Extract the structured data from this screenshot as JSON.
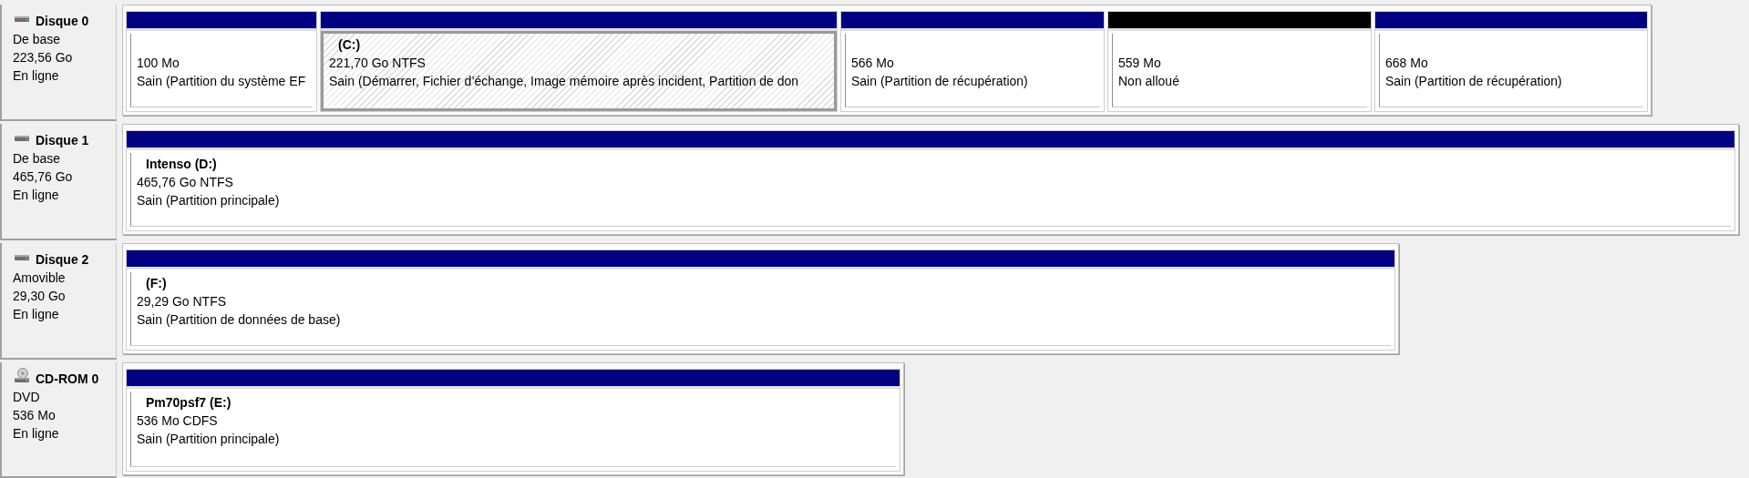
{
  "disks": [
    {
      "name": "Disque 0",
      "kind": "disk",
      "type": "De base",
      "size": "223,56 Go",
      "status": "En ligne",
      "partitions": [
        {
          "kind": "allocated",
          "selected": false,
          "size": "100 Mo",
          "status": "Sain (Partition du système EF"
        },
        {
          "kind": "allocated",
          "selected": true,
          "label": "(C:)",
          "size": "221,70 Go NTFS",
          "status": "Sain (Démarrer, Fichier d’échange, Image mémoire après incident, Partition de don"
        },
        {
          "kind": "allocated",
          "selected": false,
          "size": "566 Mo",
          "status": "Sain (Partition de récupération)"
        },
        {
          "kind": "unallocated",
          "selected": false,
          "size": "559 Mo",
          "status": "Non alloué"
        },
        {
          "kind": "allocated",
          "selected": false,
          "size": "668 Mo",
          "status": "Sain (Partition de récupération)"
        }
      ]
    },
    {
      "name": "Disque 1",
      "kind": "disk",
      "type": "De base",
      "size": "465,76 Go",
      "status": "En ligne",
      "partitions": [
        {
          "kind": "allocated",
          "selected": false,
          "label": "Intenso  (D:)",
          "size": "465,76 Go NTFS",
          "status": "Sain (Partition principale)"
        }
      ]
    },
    {
      "name": "Disque 2",
      "kind": "disk",
      "type": "Amovible",
      "size": "29,30 Go",
      "status": "En ligne",
      "partitions": [
        {
          "kind": "allocated",
          "selected": false,
          "label": "(F:)",
          "size": "29,29 Go NTFS",
          "status": "Sain (Partition de données de base)"
        }
      ]
    },
    {
      "name": "CD-ROM 0",
      "kind": "cdrom",
      "type": "DVD",
      "size": "536 Mo",
      "status": "En ligne",
      "partitions": [
        {
          "kind": "allocated",
          "selected": false,
          "label": "Pm70psf7  (E:)",
          "size": "536 Mo CDFS",
          "status": "Sain (Partition principale)"
        }
      ]
    }
  ]
}
